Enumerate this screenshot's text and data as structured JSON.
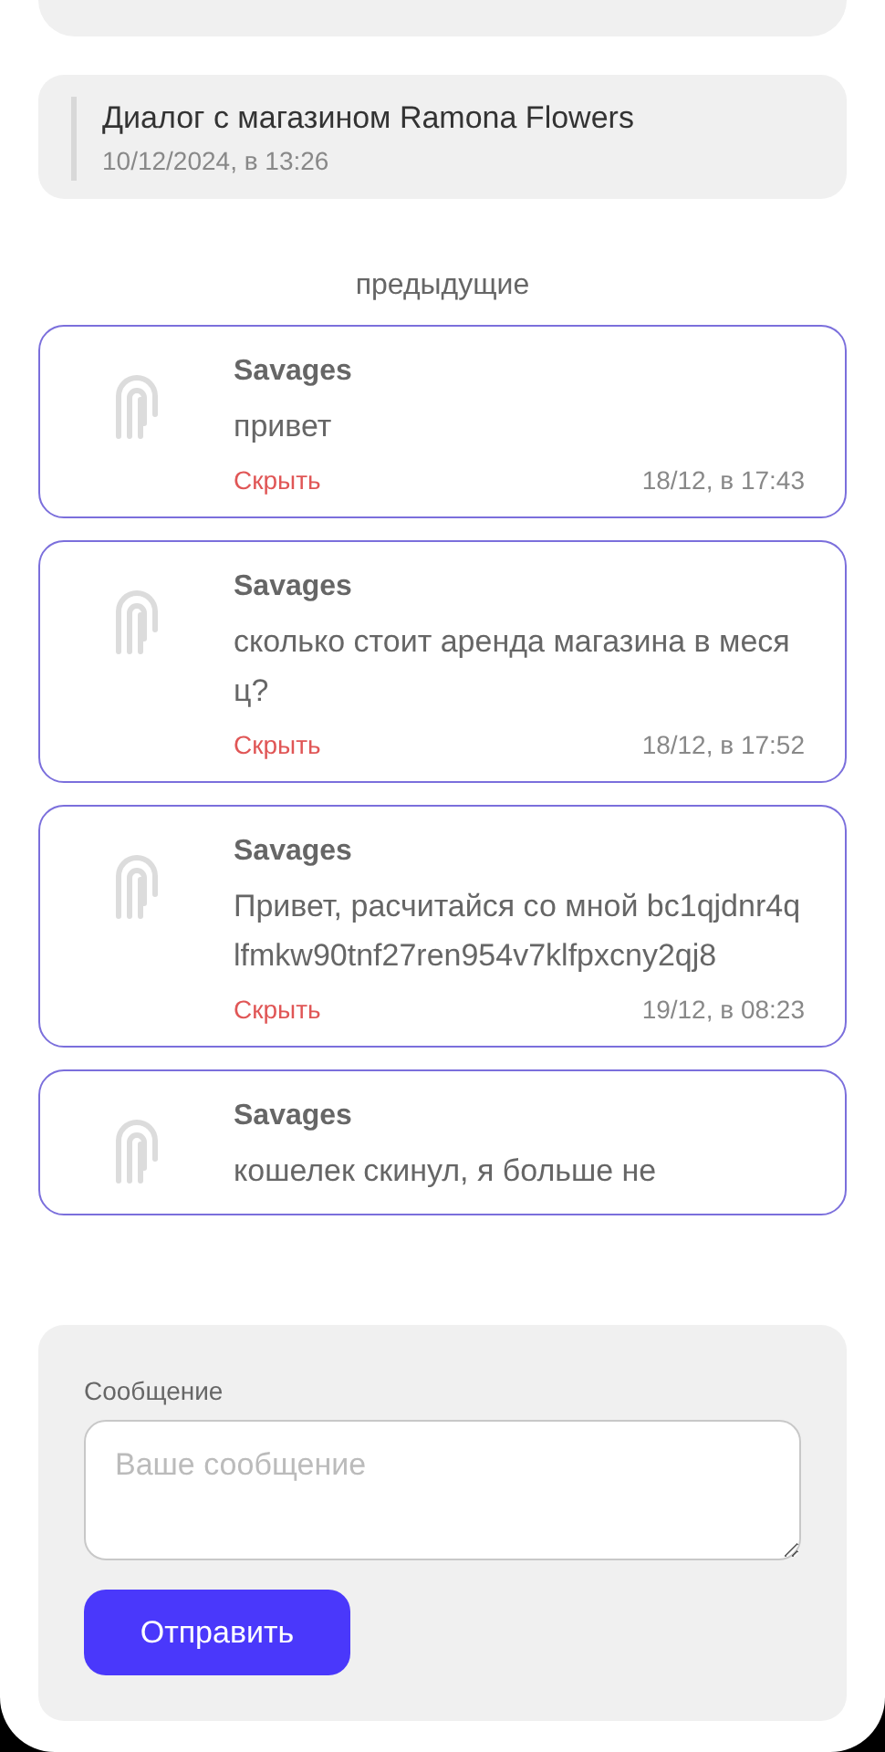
{
  "dialog": {
    "title": "Диалог с магазином Ramona Flowers",
    "date": "10/12/2024, в 13:26"
  },
  "section_label": "предыдущие",
  "messages": [
    {
      "author": "Savages",
      "text": "привет",
      "action": "Скрыть",
      "time": "18/12, в 17:43"
    },
    {
      "author": "Savages",
      "text": "сколько стоит аренда магазина в месяц?",
      "action": "Скрыть",
      "time": "18/12, в 17:52"
    },
    {
      "author": "Savages",
      "text": "Привет, расчитайся со мной bc1qjdnr4qlfmkw90tnf27ren954v7klfpxcny2qj8",
      "action": "Скрыть",
      "time": "19/12, в 08:23"
    },
    {
      "author": "Savages",
      "text": "кошелек скинул, я больше не"
    }
  ],
  "form": {
    "label": "Сообщение",
    "placeholder": "Ваше сообщение",
    "button": "Отправить"
  }
}
